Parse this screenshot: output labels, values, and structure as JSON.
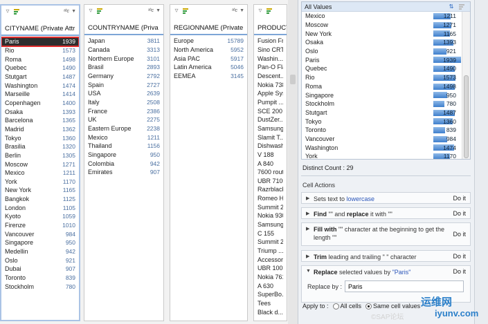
{
  "columns": [
    {
      "id": "city",
      "header": "CITYNAME (Private Attr",
      "rows": [
        [
          "Paris",
          "1939"
        ],
        [
          "Rio",
          "1573"
        ],
        [
          "Roma",
          "1498"
        ],
        [
          "Quebec",
          "1490"
        ],
        [
          "Stutgart",
          "1487"
        ],
        [
          "Washington",
          "1474"
        ],
        [
          "Marseille",
          "1414"
        ],
        [
          "Copenhagen",
          "1400"
        ],
        [
          "Osaka",
          "1393"
        ],
        [
          "Barcelona",
          "1365"
        ],
        [
          "Madrid",
          "1362"
        ],
        [
          "Tokyo",
          "1360"
        ],
        [
          "Brasilia",
          "1320"
        ],
        [
          "Berlin",
          "1305"
        ],
        [
          "Moscow",
          "1271"
        ],
        [
          "Mexico",
          "1211"
        ],
        [
          "York",
          "1170"
        ],
        [
          "New York",
          "1165"
        ],
        [
          "Bangkok",
          "1125"
        ],
        [
          "London",
          "1105"
        ],
        [
          "Kyoto",
          "1059"
        ],
        [
          "Firenze",
          "1010"
        ],
        [
          "Vancouver",
          "984"
        ],
        [
          "Singapore",
          "950"
        ],
        [
          "Medellin",
          "942"
        ],
        [
          "Oslo",
          "921"
        ],
        [
          "Dubai",
          "907"
        ],
        [
          "Toronto",
          "839"
        ],
        [
          "Stockholm",
          "780"
        ]
      ]
    },
    {
      "id": "country",
      "header": "COUNTRYNAME (Priva",
      "rows": [
        [
          "Japan",
          "3811"
        ],
        [
          "Canada",
          "3313"
        ],
        [
          "Northern Europe",
          "3101"
        ],
        [
          "Brasil",
          "2893"
        ],
        [
          "Germany",
          "2792"
        ],
        [
          "Spain",
          "2727"
        ],
        [
          "USA",
          "2639"
        ],
        [
          "Italy",
          "2508"
        ],
        [
          "France",
          "2386"
        ],
        [
          "UK",
          "2275"
        ],
        [
          "Eastern Europe",
          "2238"
        ],
        [
          "Mexico",
          "1211"
        ],
        [
          "Thailand",
          "1156"
        ],
        [
          "Singapore",
          "950"
        ],
        [
          "Colombia",
          "942"
        ],
        [
          "Emirates",
          "907"
        ]
      ]
    },
    {
      "id": "region",
      "header": "REGIONNAME (Private",
      "rows": [
        [
          "Europe",
          "15789"
        ],
        [
          "North America",
          "5952"
        ],
        [
          "Asia PAC",
          "5917"
        ],
        [
          "Latin America",
          "5046"
        ],
        [
          "EEMEA",
          "3145"
        ]
      ]
    },
    {
      "id": "product",
      "header": "PRODUCT",
      "rows": [
        [
          "Fusion Fri",
          ""
        ],
        [
          "Sino CRT",
          ""
        ],
        [
          "Washin...M",
          ""
        ],
        [
          "Pan-O Flat",
          ""
        ],
        [
          "Descent...",
          ""
        ],
        [
          "Nokia 7380",
          ""
        ],
        [
          "Apple Syst",
          ""
        ],
        [
          "Pumpit ...",
          ""
        ],
        [
          "SCE 200",
          ""
        ],
        [
          "DustZer...",
          ""
        ],
        [
          "Samsung",
          ""
        ],
        [
          "Slamit T...",
          ""
        ],
        [
          "Dishwashe",
          ""
        ],
        [
          "V 188",
          ""
        ],
        [
          "A 840",
          ""
        ],
        [
          "7600 route",
          ""
        ],
        [
          "UBR 7100",
          ""
        ],
        [
          "Razrblack",
          ""
        ],
        [
          "Romeo H...",
          ""
        ],
        [
          "Summit 20",
          ""
        ],
        [
          "Nokia 9300",
          ""
        ],
        [
          "Samsung X",
          ""
        ],
        [
          "C 155",
          ""
        ],
        [
          "Summit 20",
          ""
        ],
        [
          "Triump ...",
          ""
        ],
        [
          "Accessorie",
          ""
        ],
        [
          "UBR 10012",
          ""
        ],
        [
          "Nokia 7610",
          ""
        ],
        [
          "A 630",
          ""
        ],
        [
          "SuperBo...",
          ""
        ],
        [
          "Tees",
          ""
        ],
        [
          "Black d...",
          ""
        ]
      ]
    }
  ],
  "value_list": {
    "header": "All Values",
    "rows": [
      [
        "Mexico",
        "1211"
      ],
      [
        "Moscow",
        "1271"
      ],
      [
        "New York",
        "1165"
      ],
      [
        "Osaka",
        "1393"
      ],
      [
        "Oslo",
        "921"
      ],
      [
        "Paris",
        "1939"
      ],
      [
        "Quebec",
        "1490"
      ],
      [
        "Rio",
        "1573"
      ],
      [
        "Roma",
        "1498"
      ],
      [
        "Singapore",
        "950"
      ],
      [
        "Stockholm",
        "780"
      ],
      [
        "Stutgart",
        "1487"
      ],
      [
        "Tokyo",
        "1360"
      ],
      [
        "Toronto",
        "839"
      ],
      [
        "Vancouver",
        "984"
      ],
      [
        "Washington",
        "1474"
      ],
      [
        "York",
        "1170"
      ]
    ],
    "bar_fraction_max": 1939
  },
  "distinct_count": "Distinct Count : 29",
  "cell_actions_title": "Cell Actions",
  "actions": {
    "a1": {
      "pre": "Sets text to ",
      "kw": "lowercase",
      "doit": "Do it"
    },
    "a2": {
      "b1": "Find",
      "t1": " \"\" and ",
      "b2": "replace",
      "t2": " it with \"\"",
      "doit": "Do it"
    },
    "a3": {
      "b1": "Fill with",
      "t1": " \"\" character at the beginning to get the length \"\"",
      "doit": "Do it"
    },
    "a4": {
      "b1": "Trim",
      "t1": " leading and trailing \" \" character",
      "doit": "Do it"
    },
    "a5": {
      "b1": "Replace",
      "t1": " selected values by ",
      "kw": "\"Paris\"",
      "doit": "Do it",
      "field_label": "Replace by :",
      "field_value": "Paris"
    }
  },
  "apply_to": {
    "label": "Apply to :",
    "opt1": "All cells",
    "opt2": "Same cell values"
  },
  "watermark": {
    "line1": "运维网",
    "line2": "iyunv.com",
    "line3": "©SAP论坛"
  },
  "colors": {
    "selection_outline": "#e12d2d",
    "header_underline": "#7da5d6",
    "bar": "#3f7fcc"
  }
}
